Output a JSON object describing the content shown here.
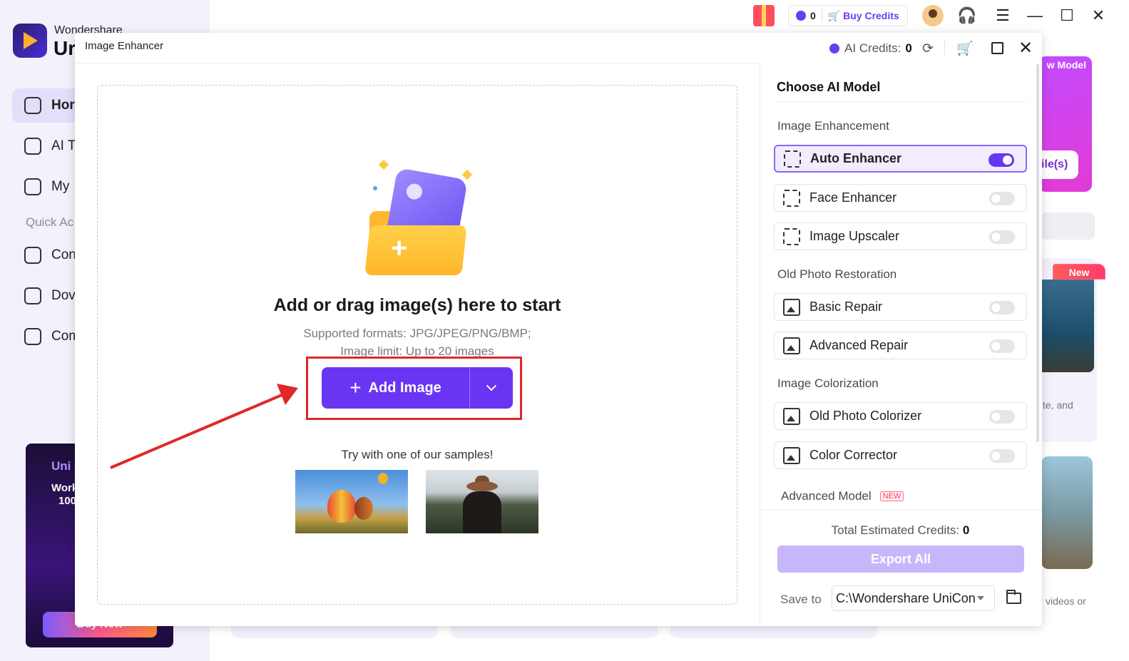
{
  "bg_app": {
    "brand_small": "Wondershare",
    "brand_big": "Ur",
    "nav": [
      {
        "label": "Hor",
        "active": true
      },
      {
        "label": "AI Te",
        "active": false
      },
      {
        "label": "My",
        "active": false
      }
    ],
    "quick_access_label": "Quick Ac",
    "quick_items": [
      "Con",
      "Dov",
      "Com"
    ],
    "promo": {
      "title": "Uni",
      "line1": "Work",
      "line2": "100",
      "button": "Buy Now"
    },
    "topbar": {
      "credits": "0",
      "buy_credits": "Buy Credits"
    },
    "right_cards": {
      "card1_tag": "w Model",
      "card1_pill": "ile(s)",
      "card2_tag": "New",
      "card2_text": "te, and",
      "card3_text": "videos or"
    }
  },
  "dialog": {
    "title": "Image Enhancer",
    "ai_credits_label": "AI Credits:",
    "ai_credits_value": "0",
    "dropzone": {
      "title": "Add or drag image(s) here to start",
      "formats": "Supported formats: JPG/JPEG/PNG/BMP;",
      "limit": "Image limit: Up to 20 images",
      "add_button": "Add Image",
      "samples_label": "Try with one of our samples!"
    },
    "panel": {
      "title": "Choose AI Model",
      "sections": {
        "enhancement": "Image Enhancement",
        "restoration": "Old Photo Restoration",
        "colorization": "Image Colorization",
        "advanced": "Advanced Model"
      },
      "models": {
        "auto": "Auto Enhancer",
        "face": "Face Enhancer",
        "upscale": "Image Upscaler",
        "basic": "Basic Repair",
        "advanced_repair": "Advanced Repair",
        "colorizer": "Old Photo Colorizer",
        "corrector": "Color Corrector"
      },
      "new_tag": "NEW",
      "total_label": "Total Estimated Credits:",
      "total_value": "0",
      "export": "Export All",
      "save_to_label": "Save to",
      "save_path": "C:\\Wondershare UniCon"
    }
  },
  "colors": {
    "accent": "#6a35f2",
    "highlight": "#e02828",
    "export_disabled": "#c8b6fb"
  },
  "toggles": {
    "auto": true,
    "face": false,
    "upscale": false,
    "basic": false,
    "advanced_repair": false,
    "colorizer": false,
    "corrector": false
  }
}
